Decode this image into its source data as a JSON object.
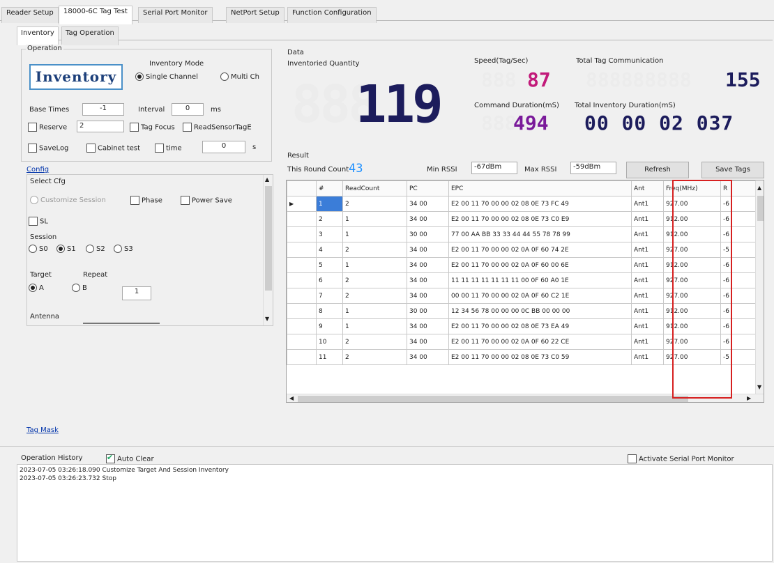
{
  "top_tabs": [
    "Reader Setup",
    "18000-6C Tag Test",
    "Serial Port Monitor",
    "NetPort Setup",
    "Function Configuration"
  ],
  "sub_tabs": [
    "Inventory",
    "Tag Operation"
  ],
  "operation": {
    "legend": "Operation",
    "inventory_button": "Inventory",
    "mode_label": "Inventory Mode",
    "single_channel": "Single Channel",
    "multi_channel": "Multi Ch",
    "base_times_label": "Base Times",
    "base_times_value": "-1",
    "interval_label": "Interval",
    "interval_value": "0",
    "interval_unit": "ms",
    "reserve_label": "Reserve",
    "reserve_value": "2",
    "tag_focus_label": "Tag Focus",
    "read_sensor_label": "ReadSensorTagE",
    "save_log_label": "SaveLog",
    "cabinet_test_label": "Cabinet test",
    "time_label": "time",
    "time_value": "0",
    "time_unit": "s"
  },
  "config": {
    "link": "Config",
    "select_cfg": "Select Cfg",
    "customize_session": "Customize Session",
    "phase": "Phase",
    "power_save": "Power Save",
    "sl": "SL",
    "session_label": "Session",
    "sessions": [
      "S0",
      "S1",
      "S2",
      "S3"
    ],
    "target_label": "Target",
    "repeat_label": "Repeat",
    "target_a": "A",
    "target_b": "B",
    "repeat_value": "1",
    "antenna_label": "Antenna"
  },
  "tag_mask_link": "Tag Mask",
  "data": {
    "legend": "Data",
    "inventoried_qty_label": "Inventoried Quantity",
    "inventoried_qty_value": "119",
    "speed_label": "Speed(Tag/Sec)",
    "speed_value": "87",
    "total_comm_label": "Total Tag Communication",
    "total_comm_value": "155",
    "cmd_duration_label": "Command Duration(mS)",
    "cmd_duration_value": "494",
    "total_duration_label": "Total Inventory Duration(mS)",
    "total_duration_value": "00 00 02 037"
  },
  "result": {
    "legend": "Result",
    "round_count_label": "This Round Count",
    "round_count_value": "43",
    "min_rssi_label": "Min RSSI",
    "min_rssi_value": "-67dBm",
    "max_rssi_label": "Max RSSI",
    "max_rssi_value": "-59dBm",
    "refresh_button": "Refresh",
    "save_tags_button": "Save Tags",
    "columns": [
      "#",
      "ReadCount",
      "PC",
      "EPC",
      "Ant",
      "Freq(MHz)",
      "R"
    ],
    "rows": [
      [
        "1",
        "2",
        "34 00",
        "E2 00 11 70 00 00 02 08 0E 73 FC 49",
        "Ant1",
        "927.00",
        "-6"
      ],
      [
        "2",
        "1",
        "34 00",
        "E2 00 11 70 00 00 02 08 0E 73 C0 E9",
        "Ant1",
        "912.00",
        "-6"
      ],
      [
        "3",
        "1",
        "30 00",
        "77 00 AA BB 33 33 44 44 55 78 78 99",
        "Ant1",
        "912.00",
        "-6"
      ],
      [
        "4",
        "2",
        "34 00",
        "E2 00 11 70 00 00 02 0A 0F 60 74 2E",
        "Ant1",
        "927.00",
        "-5"
      ],
      [
        "5",
        "1",
        "34 00",
        "E2 00 11 70 00 00 02 0A 0F 60 00 6E",
        "Ant1",
        "912.00",
        "-6"
      ],
      [
        "6",
        "2",
        "34 00",
        "11 11 11 11 11 11 11 00 0F 60 A0 1E",
        "Ant1",
        "927.00",
        "-6"
      ],
      [
        "7",
        "2",
        "34 00",
        "00 00 11 70 00 00 02 0A 0F 60 C2 1E",
        "Ant1",
        "927.00",
        "-6"
      ],
      [
        "8",
        "1",
        "30 00",
        "12 34 56 78 00 00 00 0C BB 00 00 00",
        "Ant1",
        "912.00",
        "-6"
      ],
      [
        "9",
        "1",
        "34 00",
        "E2 00 11 70 00 00 02 08 0E 73 EA 49",
        "Ant1",
        "912.00",
        "-6"
      ],
      [
        "10",
        "2",
        "34 00",
        "E2 00 11 70 00 00 02 0A 0F 60 22 CE",
        "Ant1",
        "927.00",
        "-6"
      ],
      [
        "11",
        "2",
        "34 00",
        "E2 00 11 70 00 00 02 08 0E 73 C0 59",
        "Ant1",
        "927.00",
        "-5"
      ]
    ]
  },
  "history": {
    "label": "Operation History",
    "auto_clear": "Auto Clear",
    "activate_monitor": "Activate Serial Port Monitor",
    "lines": [
      "2023-07-05 03:26:18.090 Customize Target And Session Inventory",
      "2023-07-05 03:26:23.732 Stop"
    ]
  },
  "colors": {
    "digit_blue": "#1c1c5c",
    "digit_magenta": "#c21a7a",
    "digit_purple": "#7a1a9a",
    "count_blue": "#1e90ff",
    "highlight_red": "#d62020"
  }
}
